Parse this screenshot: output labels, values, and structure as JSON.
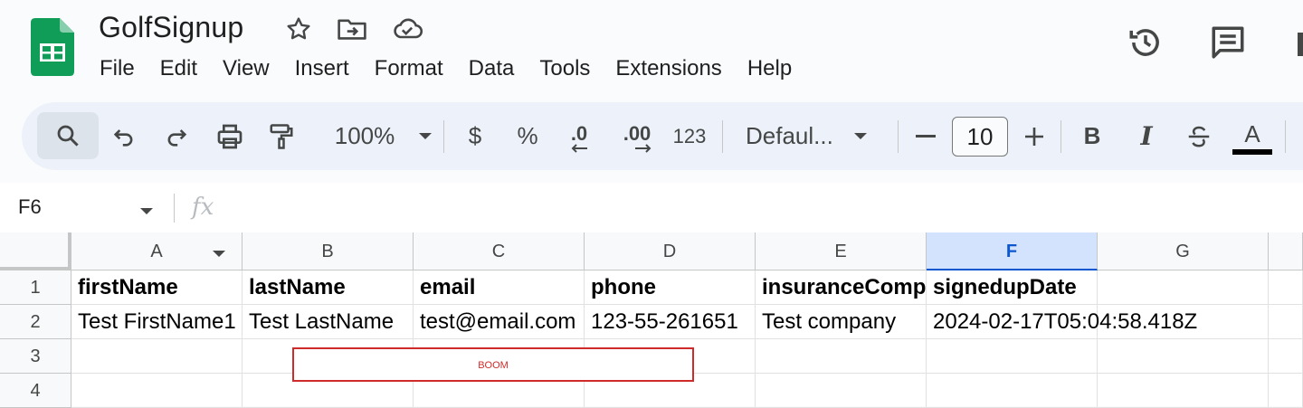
{
  "app": {
    "doc_title": "GolfSignup",
    "menu": [
      "File",
      "Edit",
      "View",
      "Insert",
      "Format",
      "Data",
      "Tools",
      "Extensions",
      "Help"
    ]
  },
  "toolbar": {
    "zoom": "100%",
    "currency": "$",
    "percent": "%",
    "decrease_decimal": ".0",
    "increase_decimal": ".00",
    "number_format": "123",
    "font": "Defaul...",
    "font_size": "10",
    "bold": "B",
    "italic": "I",
    "text_color": "A"
  },
  "formula_bar": {
    "name_box": "F6",
    "fx": "fx"
  },
  "grid": {
    "columns": [
      "A",
      "B",
      "C",
      "D",
      "E",
      "F",
      "G"
    ],
    "selected_column": "F",
    "rows": [
      "1",
      "2",
      "3",
      "4"
    ],
    "row1": [
      "firstName",
      "lastName",
      "email",
      "phone",
      "insuranceComp",
      "signedupDate",
      ""
    ],
    "row2": [
      "Test FirstName1",
      "Test LastName",
      "test@email.com",
      "123-55-261651",
      "Test company",
      "2024-02-17T05:04:58.418Z",
      ""
    ]
  },
  "overlay": {
    "label": "BOOM"
  },
  "colors": {
    "sheets_green": "#0f9d58",
    "accent_blue": "#0b57d0",
    "overlay_red": "#d02b2b"
  }
}
